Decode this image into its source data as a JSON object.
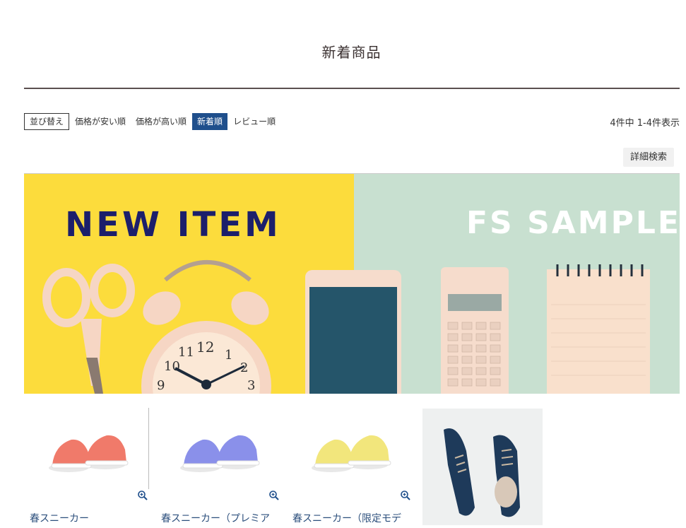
{
  "page": {
    "title": "新着商品"
  },
  "sort": {
    "label": "並び替え",
    "options": [
      {
        "label": "価格が安い順",
        "active": false
      },
      {
        "label": "価格が高い順",
        "active": false
      },
      {
        "label": "新着順",
        "active": true
      },
      {
        "label": "レビュー順",
        "active": false
      }
    ],
    "active_color": "#1f4f8c"
  },
  "result_count": "4件中 1-4件表示",
  "advanced_search_label": "詳細検索",
  "banner": {
    "left_text": "NEW ITEM",
    "right_text": "FS SAMPLE",
    "left_bg": "#fcdc3c",
    "right_bg": "#c8e0d0",
    "left_text_color": "#1c1f6b",
    "right_text_color": "#ffffff"
  },
  "products": [
    {
      "name": "春スニーカー",
      "color": "#f07a6a",
      "icon": "zoom-in-icon"
    },
    {
      "name": "春スニーカー（プレミア",
      "color": "#8a90ea",
      "icon": "zoom-in-icon"
    },
    {
      "name": "春スニーカー（限定モデ",
      "color": "#f2e67c",
      "icon": "zoom-in-icon"
    },
    {
      "name": "",
      "color": "#1e3a5a",
      "icon": ""
    }
  ]
}
